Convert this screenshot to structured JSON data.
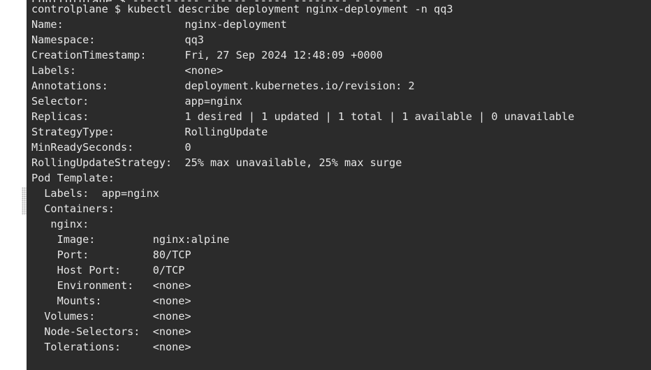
{
  "terminal": {
    "lines": [
      "controlplane $ kubectl describe deployment nginx-deployment -n qq3",
      "Name:                   nginx-deployment",
      "Namespace:              qq3",
      "CreationTimestamp:      Fri, 27 Sep 2024 12:48:09 +0000",
      "Labels:                 <none>",
      "Annotations:            deployment.kubernetes.io/revision: 2",
      "Selector:               app=nginx",
      "Replicas:               1 desired | 1 updated | 1 total | 1 available | 0 unavailable",
      "StrategyType:           RollingUpdate",
      "MinReadySeconds:        0",
      "RollingUpdateStrategy:  25% max unavailable, 25% max surge",
      "Pod Template:",
      "  Labels:  app=nginx",
      "  Containers:",
      "   nginx:",
      "    Image:         nginx:alpine",
      "    Port:          80/TCP",
      "    Host Port:     0/TCP",
      "    Environment:   <none>",
      "    Mounts:        <none>",
      "  Volumes:         <none>",
      "  Node-Selectors:  <none>",
      "  Tolerations:     <none>"
    ]
  }
}
